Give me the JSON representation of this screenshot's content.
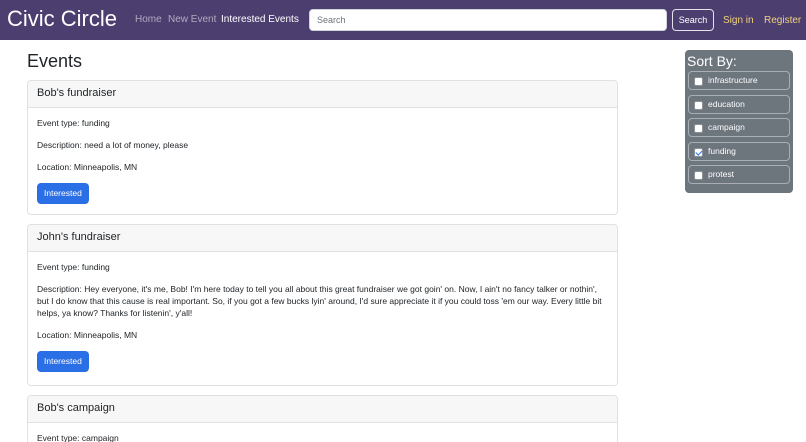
{
  "navbar": {
    "brand": "Civic Circle",
    "links": [
      "Home",
      "New Event",
      "Interested Events"
    ],
    "search_placeholder": "Search",
    "search_button": "Search",
    "sign_in": "Sign in",
    "register": "Register"
  },
  "page": {
    "title": "Events"
  },
  "events": [
    {
      "title": "Bob's fundraiser",
      "type": "Event type: funding",
      "description": "Description: need a lot of money, please",
      "location": "Location: Minneapolis, MN",
      "button": "Interested"
    },
    {
      "title": "John's fundraiser",
      "type": "Event type: funding",
      "description": "Description: Hey everyone, it's me, Bob! I'm here today to tell you all about this great fundraiser we got goin' on. Now, I ain't no fancy talker or nothin', but I do know that this cause is real important. So, if you got a few bucks lyin' around, I'd sure appreciate it if you could toss 'em our way. Every little bit helps, ya know? Thanks for listenin', y'all!",
      "location": "Location: Minneapolis, MN",
      "button": "Interested"
    },
    {
      "title": "Bob's campaign",
      "type": "Event type: campaign"
    }
  ],
  "sort": {
    "title": "Sort By:",
    "options": [
      {
        "label": "infrastructure",
        "checked": false
      },
      {
        "label": "education",
        "checked": false
      },
      {
        "label": "campaign",
        "checked": false
      },
      {
        "label": "funding",
        "checked": true
      },
      {
        "label": "protest",
        "checked": false
      }
    ]
  },
  "colors": {
    "navbar": "#4d3e70",
    "primary_button": "#2b6fe6",
    "sort_panel": "#6d757d",
    "auth_link": "#f0d27a"
  }
}
